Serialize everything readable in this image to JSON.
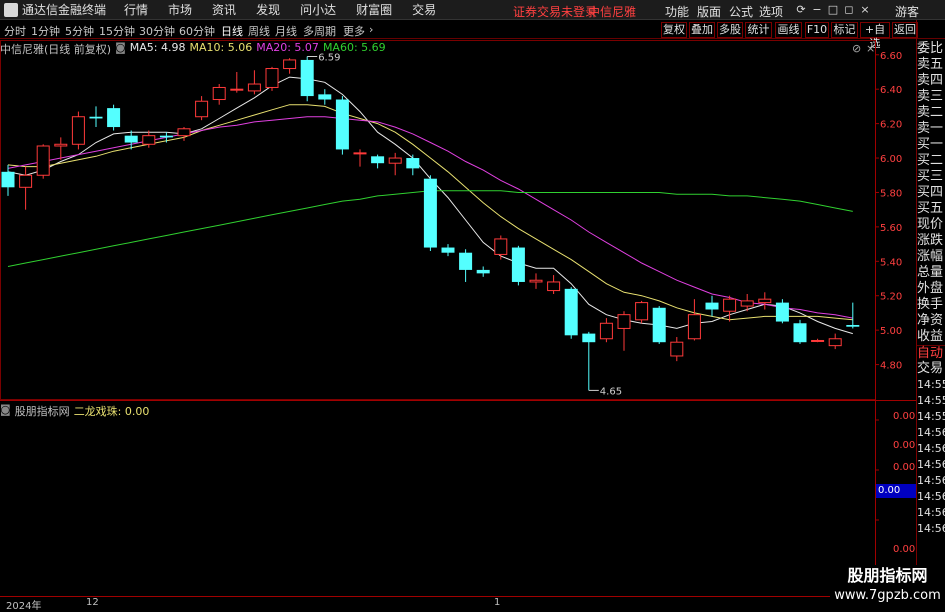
{
  "app": {
    "name": "通达信金融终端",
    "menu": [
      "行情",
      "市场",
      "资讯",
      "发现",
      "问小达",
      "财富圈",
      "交易"
    ],
    "login_status": "证券交易未登录",
    "stock_name": "中信尼雅",
    "right_menu": [
      "功能",
      "版面",
      "公式",
      "选项"
    ],
    "user": "游客"
  },
  "toolbar": {
    "periods": [
      "分时",
      "1分钟",
      "5分钟",
      "15分钟",
      "30分钟",
      "60分钟",
      "日线",
      "周线",
      "月线",
      "多周期",
      "更多"
    ],
    "active_period": "日线",
    "right_buttons": [
      "复权",
      "叠加",
      "多股",
      "统计",
      "画线",
      "F10",
      "标记",
      "+自选",
      "返回"
    ]
  },
  "main_chart": {
    "title": "中信尼雅(日线 前复权)",
    "ma": [
      {
        "label": "MA5: 4.98",
        "color": "#ffffff"
      },
      {
        "label": "MA10: 5.06",
        "color": "#e8e070"
      },
      {
        "label": "MA20: 5.07",
        "color": "#e040e0"
      },
      {
        "label": "MA60: 5.69",
        "color": "#30d030"
      }
    ],
    "high_label": "6.59",
    "low_label": "4.65",
    "price_ticks": [
      "6.60",
      "6.40",
      "6.20",
      "6.00",
      "5.80",
      "5.60",
      "5.40",
      "5.20",
      "5.00",
      "4.80"
    ]
  },
  "sub_chart": {
    "indicator": "股朋指标网",
    "line_label": "二龙戏珠: 0.00",
    "ticks": [
      "0.00",
      "0.00",
      "0.00",
      "0.00"
    ],
    "current_value": "0.00"
  },
  "right_panel": {
    "items": [
      "委比",
      "卖五",
      "卖四",
      "卖三",
      "卖二",
      "卖一",
      "买一",
      "买二",
      "买三",
      "买四",
      "买五",
      "现价",
      "涨跌",
      "涨幅",
      "总量",
      "外盘",
      "换手",
      "净资",
      "收益"
    ],
    "tabs": [
      "自动",
      "交易"
    ],
    "times": [
      "14:55",
      "14:55",
      "14:55",
      "14:56",
      "14:56",
      "14:56",
      "14:56",
      "14:56",
      "14:56",
      "14:56"
    ]
  },
  "xaxis": {
    "labels": [
      "2024年",
      "12",
      "1"
    ]
  },
  "watermark": {
    "line1": "股朋指标网",
    "line2": "www.7gpzb.com"
  },
  "chart_data": {
    "type": "candlestick",
    "ylim": [
      4.6,
      6.68
    ],
    "candles": [
      [
        5.92,
        5.83,
        5.96,
        5.78
      ],
      [
        5.83,
        5.9,
        5.95,
        5.7
      ],
      [
        5.9,
        6.07,
        6.08,
        5.88
      ],
      [
        6.07,
        6.08,
        6.12,
        5.99
      ],
      [
        6.08,
        6.24,
        6.27,
        6.05
      ],
      [
        6.24,
        6.23,
        6.3,
        6.18
      ],
      [
        6.29,
        6.18,
        6.31,
        6.16
      ],
      [
        6.13,
        6.09,
        6.16,
        6.05
      ],
      [
        6.08,
        6.13,
        6.16,
        6.06
      ],
      [
        6.13,
        6.12,
        6.15,
        6.09
      ],
      [
        6.13,
        6.17,
        6.18,
        6.1
      ],
      [
        6.24,
        6.33,
        6.36,
        6.22
      ],
      [
        6.34,
        6.41,
        6.43,
        6.31
      ],
      [
        6.4,
        6.4,
        6.5,
        6.38
      ],
      [
        6.39,
        6.43,
        6.51,
        6.37
      ],
      [
        6.41,
        6.52,
        6.53,
        6.39
      ],
      [
        6.52,
        6.57,
        6.58,
        6.49
      ],
      [
        6.57,
        6.36,
        6.59,
        6.33
      ],
      [
        6.37,
        6.34,
        6.4,
        6.31
      ],
      [
        6.34,
        6.05,
        6.36,
        6.02
      ],
      [
        6.03,
        6.03,
        6.05,
        5.95
      ],
      [
        6.01,
        5.97,
        6.02,
        5.94
      ],
      [
        5.97,
        6.0,
        6.03,
        5.9
      ],
      [
        6.0,
        5.94,
        6.02,
        5.9
      ],
      [
        5.88,
        5.48,
        5.9,
        5.46
      ],
      [
        5.48,
        5.45,
        5.5,
        5.43
      ],
      [
        5.45,
        5.35,
        5.47,
        5.28
      ],
      [
        5.35,
        5.33,
        5.37,
        5.31
      ],
      [
        5.44,
        5.53,
        5.55,
        5.41
      ],
      [
        5.48,
        5.28,
        5.49,
        5.26
      ],
      [
        5.28,
        5.29,
        5.33,
        5.24
      ],
      [
        5.23,
        5.28,
        5.32,
        5.21
      ],
      [
        5.24,
        4.97,
        5.25,
        4.95
      ],
      [
        4.98,
        4.93,
        4.99,
        4.65
      ],
      [
        4.95,
        5.04,
        5.07,
        4.93
      ],
      [
        5.01,
        5.09,
        5.11,
        4.88
      ],
      [
        5.06,
        5.16,
        5.17,
        5.04
      ],
      [
        5.13,
        4.93,
        5.14,
        4.92
      ],
      [
        4.85,
        4.93,
        4.96,
        4.82
      ],
      [
        4.95,
        5.09,
        5.18,
        4.94
      ],
      [
        5.16,
        5.12,
        5.2,
        5.08
      ],
      [
        5.11,
        5.18,
        5.2,
        5.05
      ],
      [
        5.14,
        5.17,
        5.21,
        5.11
      ],
      [
        5.16,
        5.18,
        5.22,
        5.12
      ],
      [
        5.16,
        5.05,
        5.18,
        5.04
      ],
      [
        5.04,
        4.93,
        5.06,
        4.92
      ],
      [
        4.94,
        4.94,
        4.95,
        4.93
      ],
      [
        4.91,
        4.95,
        4.98,
        4.89
      ],
      [
        5.03,
        5.02,
        5.16,
        5.01
      ]
    ],
    "ma_series": [
      {
        "name": "MA5",
        "color": "#e8e8e8",
        "values": [
          5.92,
          5.9,
          5.93,
          5.98,
          6.02,
          6.09,
          6.14,
          6.15,
          6.15,
          6.15,
          6.14,
          6.17,
          6.23,
          6.29,
          6.35,
          6.42,
          6.47,
          6.46,
          6.44,
          6.37,
          6.27,
          6.15,
          6.08,
          6.0,
          5.88,
          5.77,
          5.64,
          5.51,
          5.43,
          5.39,
          5.36,
          5.36,
          5.27,
          5.15,
          5.09,
          5.06,
          5.04,
          5.03,
          5.01,
          5.04,
          5.05,
          5.09,
          5.12,
          5.15,
          5.14,
          5.1,
          5.05,
          5.01,
          4.98
        ]
      },
      {
        "name": "MA10",
        "color": "#e8e070",
        "values": [
          5.96,
          5.95,
          5.95,
          5.97,
          5.99,
          6.01,
          6.04,
          6.06,
          6.08,
          6.1,
          6.12,
          6.16,
          6.19,
          6.22,
          6.25,
          6.28,
          6.31,
          6.31,
          6.3,
          6.26,
          6.23,
          6.2,
          6.15,
          6.08,
          6.0,
          5.92,
          5.83,
          5.74,
          5.66,
          5.59,
          5.53,
          5.47,
          5.41,
          5.34,
          5.27,
          5.22,
          5.2,
          5.17,
          5.13,
          5.1,
          5.08,
          5.06,
          5.07,
          5.08,
          5.08,
          5.08,
          5.08,
          5.07,
          5.06
        ]
      },
      {
        "name": "MA20",
        "color": "#e040e0",
        "values": [
          5.94,
          5.96,
          5.98,
          6.0,
          6.02,
          6.04,
          6.06,
          6.08,
          6.1,
          6.12,
          6.14,
          6.16,
          6.18,
          6.19,
          6.21,
          6.22,
          6.23,
          6.24,
          6.24,
          6.23,
          6.22,
          6.21,
          6.18,
          6.14,
          6.09,
          6.04,
          5.98,
          5.93,
          5.87,
          5.82,
          5.76,
          5.7,
          5.64,
          5.57,
          5.51,
          5.45,
          5.39,
          5.34,
          5.29,
          5.25,
          5.21,
          5.19,
          5.16,
          5.15,
          5.13,
          5.12,
          5.1,
          5.09,
          5.07
        ]
      },
      {
        "name": "MA60",
        "color": "#30d030",
        "values": [
          5.37,
          5.39,
          5.41,
          5.43,
          5.45,
          5.47,
          5.49,
          5.51,
          5.53,
          5.55,
          5.57,
          5.59,
          5.61,
          5.63,
          5.65,
          5.67,
          5.69,
          5.71,
          5.73,
          5.75,
          5.76,
          5.78,
          5.79,
          5.8,
          5.81,
          5.81,
          5.81,
          5.81,
          5.81,
          5.8,
          5.8,
          5.8,
          5.8,
          5.8,
          5.8,
          5.8,
          5.8,
          5.8,
          5.79,
          5.79,
          5.79,
          5.78,
          5.78,
          5.77,
          5.76,
          5.75,
          5.73,
          5.71,
          5.69
        ]
      }
    ]
  }
}
